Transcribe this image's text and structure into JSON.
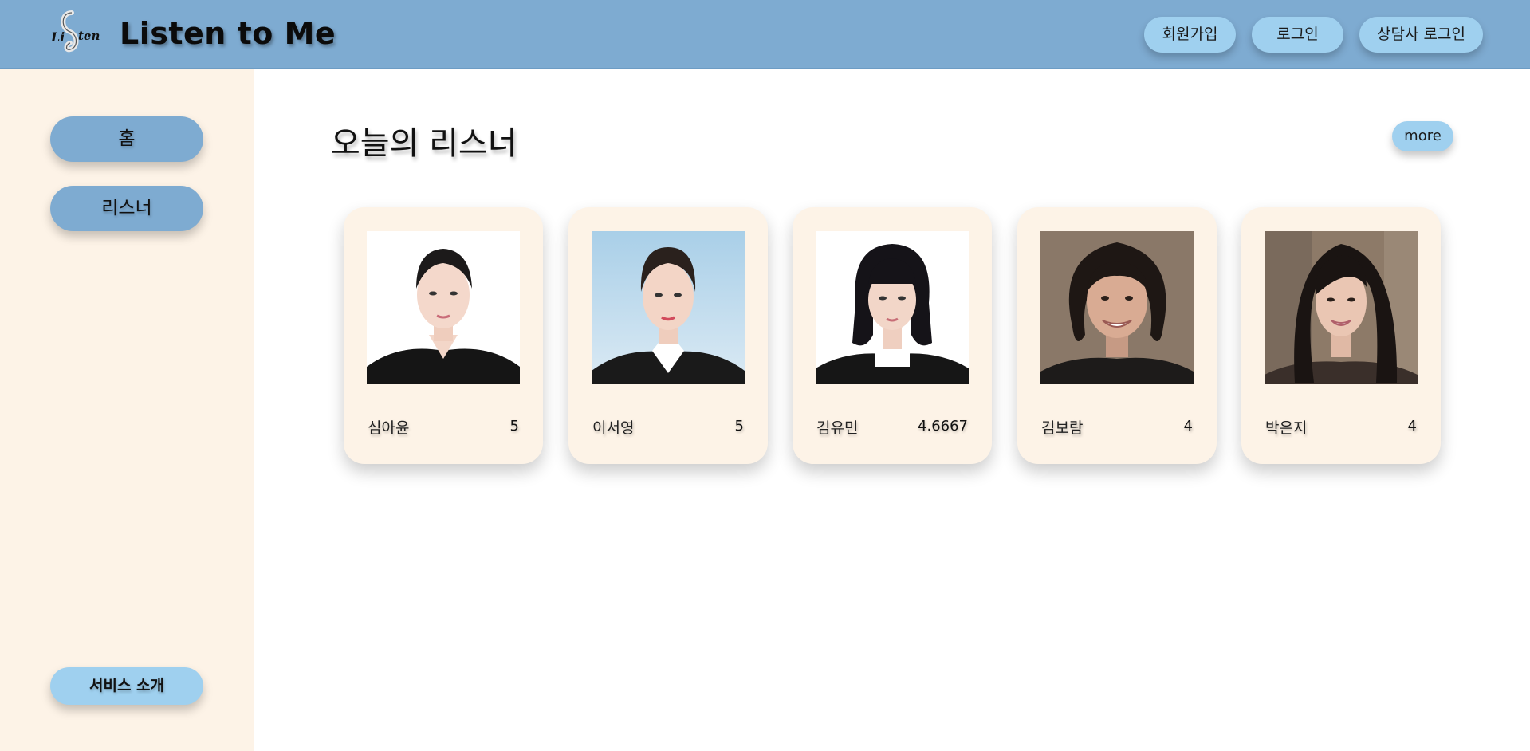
{
  "header": {
    "brand": "Listen to Me",
    "logo_text": "Listen",
    "buttons": {
      "signup": "회원가입",
      "login": "로그인",
      "counselor_login": "상담사 로그인"
    }
  },
  "sidebar": {
    "home": "홈",
    "listeners": "리스너",
    "about": "서비스 소개"
  },
  "main": {
    "section_title": "오늘의 리스너",
    "more": "more",
    "listeners": [
      {
        "name": "심아윤",
        "score": "5",
        "icon": "portrait-photo"
      },
      {
        "name": "이서영",
        "score": "5",
        "icon": "portrait-photo"
      },
      {
        "name": "김유민",
        "score": "4.6667",
        "icon": "portrait-photo"
      },
      {
        "name": "김보람",
        "score": "4",
        "icon": "portrait-photo"
      },
      {
        "name": "박은지",
        "score": "4",
        "icon": "portrait-photo"
      }
    ]
  },
  "colors": {
    "header_bg": "#7eabd1",
    "sidebar_bg": "#fdf3e7",
    "accent_light": "#9fd0ef",
    "card_bg": "#fdf3e7"
  }
}
